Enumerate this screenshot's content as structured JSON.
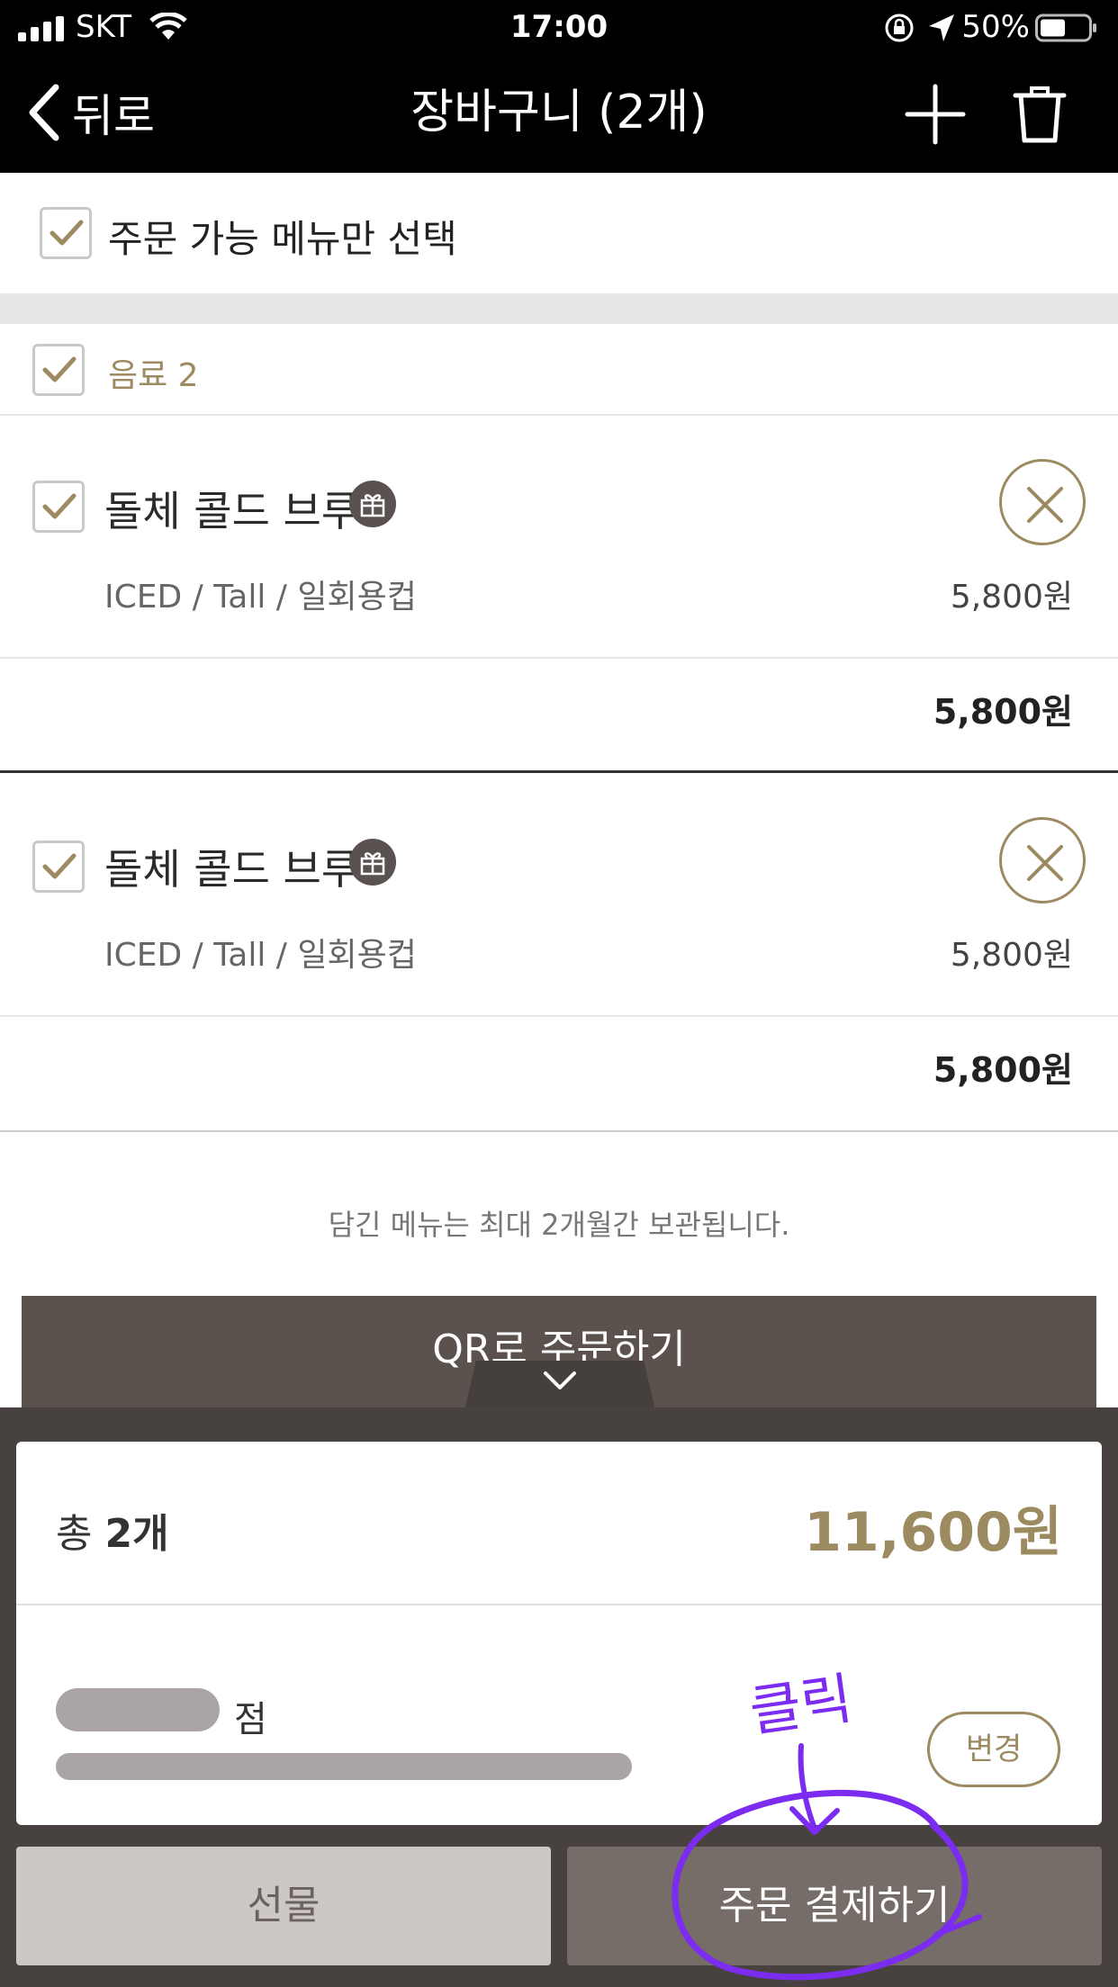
{
  "status_bar": {
    "carrier": "SKT",
    "time": "17:00",
    "battery": "50%"
  },
  "nav": {
    "back_label": "뒤로",
    "title": "장바구니 (2개)"
  },
  "select_all": {
    "label": "주문 가능 메뉴만 선택",
    "checked": true
  },
  "category": {
    "label": "음료 2",
    "checked": true
  },
  "items": [
    {
      "name": "돌체 콜드 브루",
      "options": "ICED / Tall / 일회용컵",
      "price": "5,800원",
      "subtotal": "5,800원",
      "checked": true
    },
    {
      "name": "돌체 콜드 브루",
      "options": "ICED / Tall / 일회용컵",
      "price": "5,800원",
      "subtotal": "5,800원",
      "checked": true
    }
  ],
  "notice": "담긴 메뉴는 최대 2개월간 보관됩니다.",
  "qr_button": "QR로 주문하기",
  "summary": {
    "count_prefix": "총",
    "count": "2개",
    "total": "11,600원",
    "store_suffix": "점",
    "change_label": "변경"
  },
  "buttons": {
    "gift": "선물",
    "pay": "주문 결제하기"
  },
  "annotation": {
    "text": "클릭",
    "color": "#7b2cf0"
  },
  "colors": {
    "accent": "#9c8b60",
    "dark": "#47423f",
    "pay_button": "#766c68",
    "gift_button": "#cdc8c3"
  }
}
